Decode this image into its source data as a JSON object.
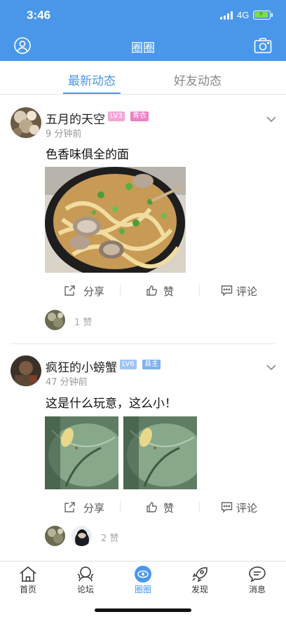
{
  "status_bar": {
    "time": "3:46",
    "network": "4G"
  },
  "header": {
    "title": "圈圈"
  },
  "tabs": [
    {
      "label": "最新动态",
      "active": true
    },
    {
      "label": "好友动态",
      "active": false
    }
  ],
  "posts": [
    {
      "username": "五月的天空",
      "level": "LV3",
      "title_badge": "青衣",
      "time": "9 分钟前",
      "text": "色香味俱全的面",
      "actions": {
        "share": "分享",
        "like": "赞",
        "comment": "评论"
      },
      "likes": "1 赞"
    },
    {
      "username": "疯狂的小螃蟹",
      "level": "LV6",
      "title_badge": "县主",
      "time": "47 分钟前",
      "text": "这是什么玩意，这么小！",
      "actions": {
        "share": "分享",
        "like": "赞",
        "comment": "评论"
      },
      "likes": "2 赞"
    }
  ],
  "bottom_nav": [
    {
      "label": "首页",
      "icon": "home-icon"
    },
    {
      "label": "论坛",
      "icon": "forum-icon"
    },
    {
      "label": "圈圈",
      "icon": "circle-eye-icon",
      "active": true
    },
    {
      "label": "发现",
      "icon": "rocket-icon"
    },
    {
      "label": "消息",
      "icon": "message-icon"
    }
  ],
  "colors": {
    "brand": "#4a97ea",
    "lv_badge_pink": "#f5a6d7",
    "lv_badge_blue": "#9fc5f5",
    "title_badge_pink": "#f27fc6",
    "title_badge_blue": "#7fb1ee"
  }
}
